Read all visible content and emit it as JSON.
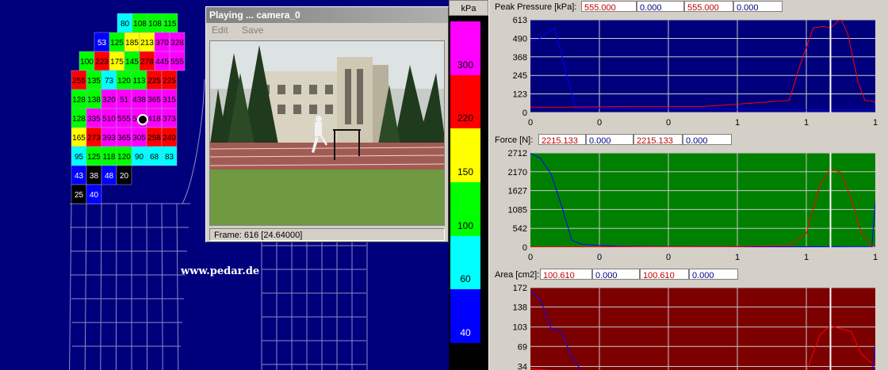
{
  "foot": {
    "watermark": "www.pedar.de",
    "rows": [
      [
        {
          "v": "80",
          "c": "#00ffff"
        },
        {
          "v": "108",
          "c": "#00ff00"
        },
        {
          "v": "108",
          "c": "#00ff00"
        },
        {
          "v": "115",
          "c": "#00ff00"
        }
      ],
      [
        {
          "v": "53",
          "c": "#0000ff"
        },
        {
          "v": "125",
          "c": "#00ff00"
        },
        {
          "v": "185",
          "c": "#ffff00"
        },
        {
          "v": "213",
          "c": "#ffff00"
        },
        {
          "v": "370",
          "c": "#ff00ff"
        },
        {
          "v": "328",
          "c": "#ff00ff"
        }
      ],
      [
        {
          "v": "100",
          "c": "#00ff00"
        },
        {
          "v": "223",
          "c": "#ff0000"
        },
        {
          "v": "175",
          "c": "#ffff00"
        },
        {
          "v": "145",
          "c": "#00ff00"
        },
        {
          "v": "278",
          "c": "#ff0000"
        },
        {
          "v": "445",
          "c": "#ff00ff"
        },
        {
          "v": "555",
          "c": "#ff00ff"
        }
      ],
      [
        {
          "v": "255",
          "c": "#ff0000"
        },
        {
          "v": "135",
          "c": "#00ff00"
        },
        {
          "v": "73",
          "c": "#00ffff"
        },
        {
          "v": "120",
          "c": "#00ff00"
        },
        {
          "v": "113",
          "c": "#00ff00"
        },
        {
          "v": "225",
          "c": "#ff0000"
        },
        {
          "v": "225",
          "c": "#ff0000"
        }
      ],
      [
        {
          "v": "128",
          "c": "#00ff00"
        },
        {
          "v": "138",
          "c": "#00ff00"
        },
        {
          "v": "320",
          "c": "#ff00ff"
        },
        {
          "v": "51",
          "c": "#ff00ff"
        },
        {
          "v": "438",
          "c": "#ff00ff"
        },
        {
          "v": "365",
          "c": "#ff00ff"
        },
        {
          "v": "315",
          "c": "#ff00ff"
        }
      ],
      [
        {
          "v": "128",
          "c": "#00ff00"
        },
        {
          "v": "335",
          "c": "#ff00ff"
        },
        {
          "v": "510",
          "c": "#ff00ff"
        },
        {
          "v": "555",
          "c": "#ff00ff"
        },
        {
          "v": "508",
          "c": "#ff00ff"
        },
        {
          "v": "418",
          "c": "#ff00ff"
        },
        {
          "v": "373",
          "c": "#ff00ff"
        }
      ],
      [
        {
          "v": "165",
          "c": "#ffff00"
        },
        {
          "v": "273",
          "c": "#ff0000"
        },
        {
          "v": "393",
          "c": "#ff00ff"
        },
        {
          "v": "365",
          "c": "#ff00ff"
        },
        {
          "v": "305",
          "c": "#ff00ff"
        },
        {
          "v": "258",
          "c": "#ff0000"
        },
        {
          "v": "240",
          "c": "#ff0000"
        }
      ],
      [
        {
          "v": "95",
          "c": "#00ffff"
        },
        {
          "v": "125",
          "c": "#00ff00"
        },
        {
          "v": "118",
          "c": "#00ff00"
        },
        {
          "v": "120",
          "c": "#00ff00"
        },
        {
          "v": "90",
          "c": "#00ffff"
        },
        {
          "v": "68",
          "c": "#00ffff"
        },
        {
          "v": "83",
          "c": "#00ffff"
        }
      ],
      [
        {
          "v": "43",
          "c": "#0000ff"
        },
        {
          "v": "38",
          "c": "#000000"
        },
        {
          "v": "48",
          "c": "#0000ff"
        },
        {
          "v": "20",
          "c": "#000000"
        }
      ],
      [
        {
          "v": "25",
          "c": "#000000"
        },
        {
          "v": "40",
          "c": "#0000ff"
        }
      ]
    ]
  },
  "video": {
    "title": "Playing ...  camera_0",
    "menu": [
      "Edit",
      "Save"
    ],
    "status": "Frame:  616 [24.64000]"
  },
  "legend": {
    "unit": "kPa",
    "segments": [
      {
        "color": "#ff00ff",
        "label": "300"
      },
      {
        "color": "#ff0000",
        "label": "220"
      },
      {
        "color": "#ffff00",
        "label": "150"
      },
      {
        "color": "#00ff00",
        "label": "100"
      },
      {
        "color": "#00ffff",
        "label": "60"
      },
      {
        "color": "#0000ff",
        "label": "40"
      }
    ]
  },
  "panels": [
    {
      "title": "Peak Pressure  [kPa]:",
      "values": [
        "555.000",
        "0.000",
        "555.000",
        "0.000"
      ],
      "bg": "#00007d",
      "y_ticks": [
        "613",
        "490",
        "368",
        "245",
        "123",
        "0"
      ],
      "x_ticks": [
        "0",
        "0",
        "0",
        "1",
        "1",
        "1"
      ],
      "chart_data": {
        "type": "line",
        "ylim": [
          0,
          613
        ],
        "xlim": [
          0,
          1
        ],
        "cursor_x": 0.87,
        "series": [
          {
            "color": "#0000ff",
            "x": [
              0,
              0.02,
              0.07,
              0.13,
              0.5,
              0.75,
              0.85,
              0.86,
              0.995,
              1.0
            ],
            "y": [
              480,
              480,
              560,
              30,
              25,
              20,
              18,
              20,
              20,
              80
            ]
          },
          {
            "color": "#ff0000",
            "x": [
              0,
              0.1,
              0.3,
              0.5,
              0.6,
              0.75,
              0.78,
              0.82,
              0.85,
              0.87,
              0.9,
              0.92,
              0.95,
              0.97,
              0.99,
              1.0
            ],
            "y": [
              35,
              35,
              40,
              40,
              55,
              80,
              300,
              560,
              570,
              560,
              620,
              520,
              200,
              80,
              75,
              70
            ]
          }
        ]
      }
    },
    {
      "title": "Force [N]:",
      "values": [
        "2215.133",
        "0.000",
        "2215.133",
        "0.000"
      ],
      "bg": "#008000",
      "y_ticks": [
        "2712",
        "2170",
        "1627",
        "1085",
        "542",
        "0"
      ],
      "x_ticks": [
        "0",
        "0",
        "0",
        "1",
        "1",
        "1"
      ],
      "chart_data": {
        "type": "line",
        "ylim": [
          0,
          2712
        ],
        "xlim": [
          0,
          1
        ],
        "cursor_x": 0.87,
        "series": [
          {
            "color": "#0000ff",
            "x": [
              0,
              0.03,
              0.06,
              0.09,
              0.12,
              0.15,
              0.25,
              0.4,
              0.55,
              0.7,
              0.99,
              1.0
            ],
            "y": [
              2700,
              2550,
              2100,
              1200,
              200,
              80,
              30,
              20,
              15,
              10,
              15,
              1300
            ]
          },
          {
            "color": "#ff0000",
            "x": [
              0,
              0.4,
              0.6,
              0.75,
              0.8,
              0.84,
              0.87,
              0.9,
              0.93,
              0.96,
              0.99,
              1.0
            ],
            "y": [
              10,
              15,
              20,
              40,
              400,
              1800,
              2250,
              2150,
              1400,
              400,
              50,
              20
            ]
          }
        ]
      }
    },
    {
      "title": "Area [cm2]:",
      "values": [
        "100.610",
        "0.000",
        "100.610",
        "0.000"
      ],
      "bg": "#7d0000",
      "y_ticks": [
        "172",
        "138",
        "103",
        "69",
        "34"
      ],
      "x_ticks": [],
      "chart_data": {
        "type": "line",
        "ylim": [
          0,
          172
        ],
        "xlim": [
          0,
          1
        ],
        "cursor_x": 0.87,
        "series": [
          {
            "color": "#0000ff",
            "x": [
              0,
              0.03,
              0.06,
              0.09,
              0.12,
              0.15,
              0.2,
              0.3,
              0.5,
              0.7,
              0.99,
              1.0
            ],
            "y": [
              165,
              150,
              100,
              95,
              50,
              25,
              20,
              18,
              15,
              15,
              15,
              70
            ]
          },
          {
            "color": "#ff0000",
            "x": [
              0,
              0.1,
              0.3,
              0.5,
              0.7,
              0.8,
              0.84,
              0.87,
              0.9,
              0.93,
              0.96,
              0.99
            ],
            "y": [
              30,
              25,
              20,
              18,
              20,
              25,
              90,
              105,
              100,
              95,
              55,
              40
            ]
          }
        ]
      }
    }
  ]
}
